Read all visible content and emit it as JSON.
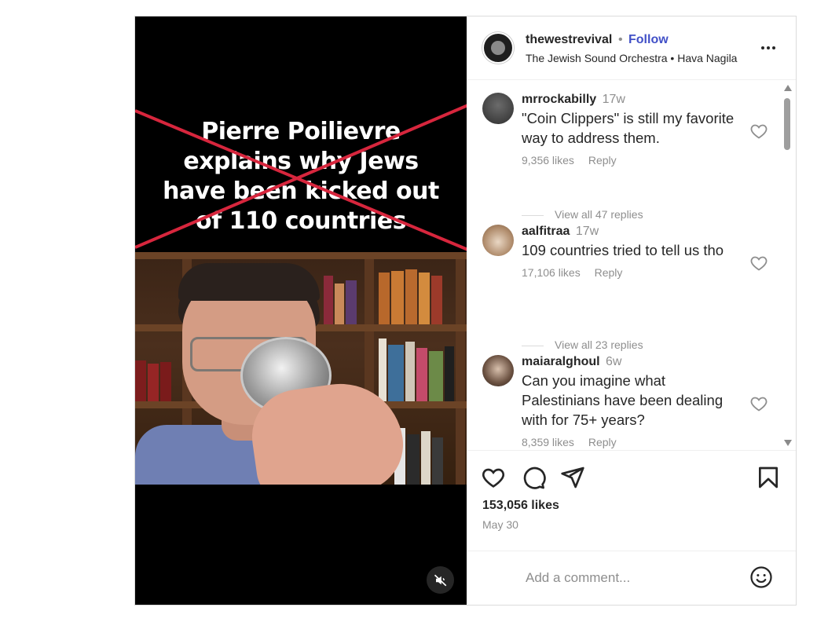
{
  "post": {
    "video": {
      "overlay_lines": [
        "Pierre Poilievre",
        "explains why Jews",
        "have been kicked out",
        "of 110 countries"
      ],
      "muted": true,
      "cross_color": "#d7263d"
    },
    "header": {
      "username": "thewestrevival",
      "separator": "•",
      "follow_label": "Follow",
      "audio": "The Jewish Sound Orchestra • Hava Nagila",
      "more_icon": "more-horizontal-icon"
    },
    "comments": [
      {
        "user": "mrrockabilly",
        "time": "17w",
        "text": "\"Coin Clippers\" is still my favorite way to address them.",
        "likes": "9,356 likes",
        "reply_label": "Reply",
        "view_replies": "View all 47 replies"
      },
      {
        "user": "aalfitraa",
        "time": "17w",
        "text": "109 countries tried to tell us tho",
        "likes": "17,106 likes",
        "reply_label": "Reply",
        "view_replies": "View all 23 replies"
      },
      {
        "user": "maiaralghoul",
        "time": "6w",
        "text": "Can you imagine what Palestinians have been dealing with for 75+ years?",
        "likes": "8,359 likes",
        "reply_label": "Reply"
      }
    ],
    "actions": {
      "likes_count": "153,056 likes",
      "date": "May 30"
    },
    "composer": {
      "placeholder": "Add a comment..."
    },
    "colors": {
      "follow_blue": "#4150c7",
      "muted_text": "#8e8e8e",
      "text": "#262626"
    }
  }
}
